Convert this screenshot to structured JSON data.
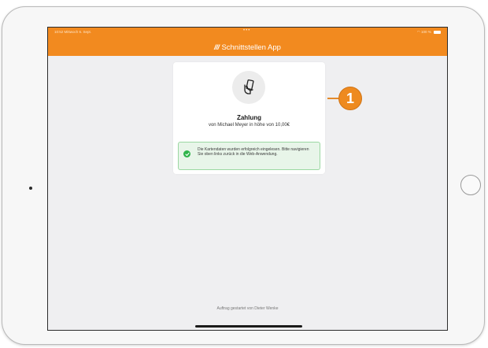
{
  "status_bar": {
    "time_date": "10:52  Mittwoch 6. Sept.",
    "dots": "•••",
    "battery": "100 %"
  },
  "header": {
    "logo": "///",
    "title": "Schnittstellen App"
  },
  "payment_card": {
    "icon": "card-in-hand-icon",
    "title": "Zahlung",
    "subtitle": "von Michael Meyer in höhe von 10,00€",
    "alert": {
      "icon": "check-circle-icon",
      "message": "Die Kartendaten wurden erfolgreich eingelesen. Bitte navigieren Sie oben links zurück in die Web-Anwendung."
    }
  },
  "footer": {
    "text": "Auftrag gestartet von Dieter Wenke"
  },
  "callout": {
    "number": "1"
  },
  "colors": {
    "accent": "#f28a1f",
    "success": "#2fb44a",
    "background": "#efeff1"
  }
}
